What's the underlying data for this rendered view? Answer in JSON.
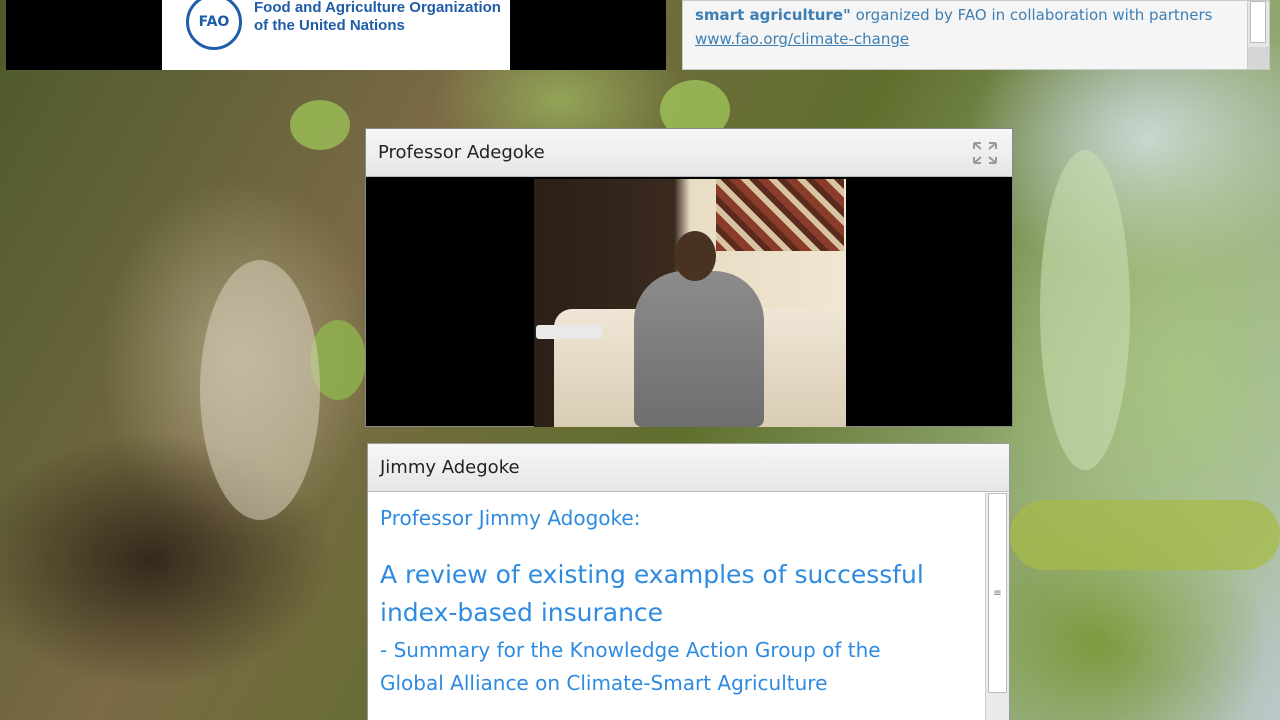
{
  "header": {
    "org_emblem_text": "FAO",
    "org_name_line1": "Food and Agriculture Organization",
    "org_name_line2": "of the United Nations"
  },
  "note": {
    "bold_text": "smart agriculture\"",
    "rest_text": " organized by FAO in collaboration with partners",
    "link_text": "www.fao.org/climate-change"
  },
  "video_pod": {
    "title": "Professor Adegoke"
  },
  "text_pod": {
    "title": "Jimmy Adegoke",
    "speaker": "Professor Jimmy Adogoke:",
    "talk_title": "A review of existing examples of successful index-based insurance",
    "talk_subtitle": "- Summary for the Knowledge Action Group of the Global Alliance on Climate-Smart Agriculture"
  },
  "colors": {
    "accent_blue": "#2f8be0",
    "fao_blue": "#1f5da8"
  },
  "icons": {
    "fullscreen": "fullscreen-icon",
    "scroll_grip": "scroll-grip-icon"
  }
}
